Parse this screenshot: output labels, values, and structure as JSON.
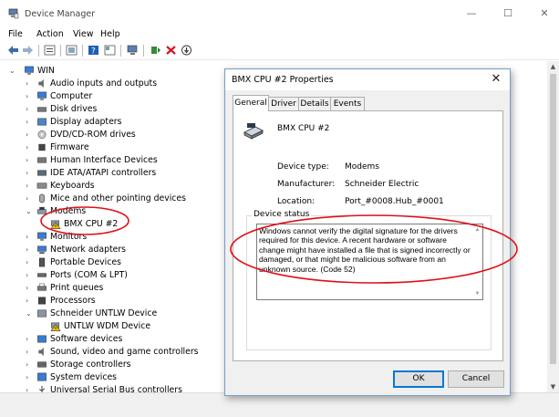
{
  "window": {
    "title": "Device Manager",
    "minimize": "—",
    "maximize": "☐",
    "close": "✕"
  },
  "menu": {
    "items": [
      "File",
      "Action",
      "View",
      "Help"
    ]
  },
  "tree": {
    "root": "WIN",
    "items": [
      {
        "label": "Audio inputs and outputs",
        "icon": "speaker-icon"
      },
      {
        "label": "Computer",
        "icon": "monitor-icon"
      },
      {
        "label": "Disk drives",
        "icon": "disk-icon"
      },
      {
        "label": "Display adapters",
        "icon": "display-icon"
      },
      {
        "label": "DVD/CD-ROM drives",
        "icon": "dvd-icon"
      },
      {
        "label": "Firmware",
        "icon": "chip-icon"
      },
      {
        "label": "Human Interface Devices",
        "icon": "hid-icon"
      },
      {
        "label": "IDE ATA/ATAPI controllers",
        "icon": "ide-icon"
      },
      {
        "label": "Keyboards",
        "icon": "keyboard-icon"
      },
      {
        "label": "Mice and other pointing devices",
        "icon": "mouse-icon"
      },
      {
        "label": "Modems",
        "icon": "modem-icon",
        "expanded": true
      },
      {
        "label": "BMX CPU #2",
        "icon": "warning-device-icon",
        "child": true
      },
      {
        "label": "Monitors",
        "icon": "monitor-icon"
      },
      {
        "label": "Network adapters",
        "icon": "network-icon"
      },
      {
        "label": "Portable Devices",
        "icon": "portable-icon"
      },
      {
        "label": "Ports (COM & LPT)",
        "icon": "port-icon"
      },
      {
        "label": "Print queues",
        "icon": "printer-icon"
      },
      {
        "label": "Processors",
        "icon": "cpu-icon"
      },
      {
        "label": "Schneider UNTLW Device",
        "icon": "device-icon",
        "expanded": true
      },
      {
        "label": "UNTLW WDM Device",
        "icon": "warning-device-icon",
        "child": true
      },
      {
        "label": "Software devices",
        "icon": "software-icon"
      },
      {
        "label": "Sound, video and game controllers",
        "icon": "speaker-icon"
      },
      {
        "label": "Storage controllers",
        "icon": "storage-icon"
      },
      {
        "label": "System devices",
        "icon": "system-icon"
      },
      {
        "label": "Universal Serial Bus controllers",
        "icon": "usb-icon"
      }
    ]
  },
  "dialog": {
    "title": "BMX CPU #2 Properties",
    "close": "✕",
    "tabs": [
      "General",
      "Driver",
      "Details",
      "Events"
    ],
    "device_name": "BMX CPU #2",
    "fields": [
      {
        "label": "Device type:",
        "value": "Modems"
      },
      {
        "label": "Manufacturer:",
        "value": "Schneider Electric"
      },
      {
        "label": "Location:",
        "value": "Port_#0008.Hub_#0001"
      }
    ],
    "status_group": "Device status",
    "status_text": "Windows cannot verify the digital signature for the drivers required for this device. A recent hardware or software change might have installed a file that is signed incorrectly or damaged, or that might be malicious software from an unknown source. (Code 52)",
    "ok": "OK",
    "cancel": "Cancel"
  },
  "colors": {
    "annotation": "#e0101a",
    "accent": "#0078d7",
    "warning": "#f2c200"
  }
}
